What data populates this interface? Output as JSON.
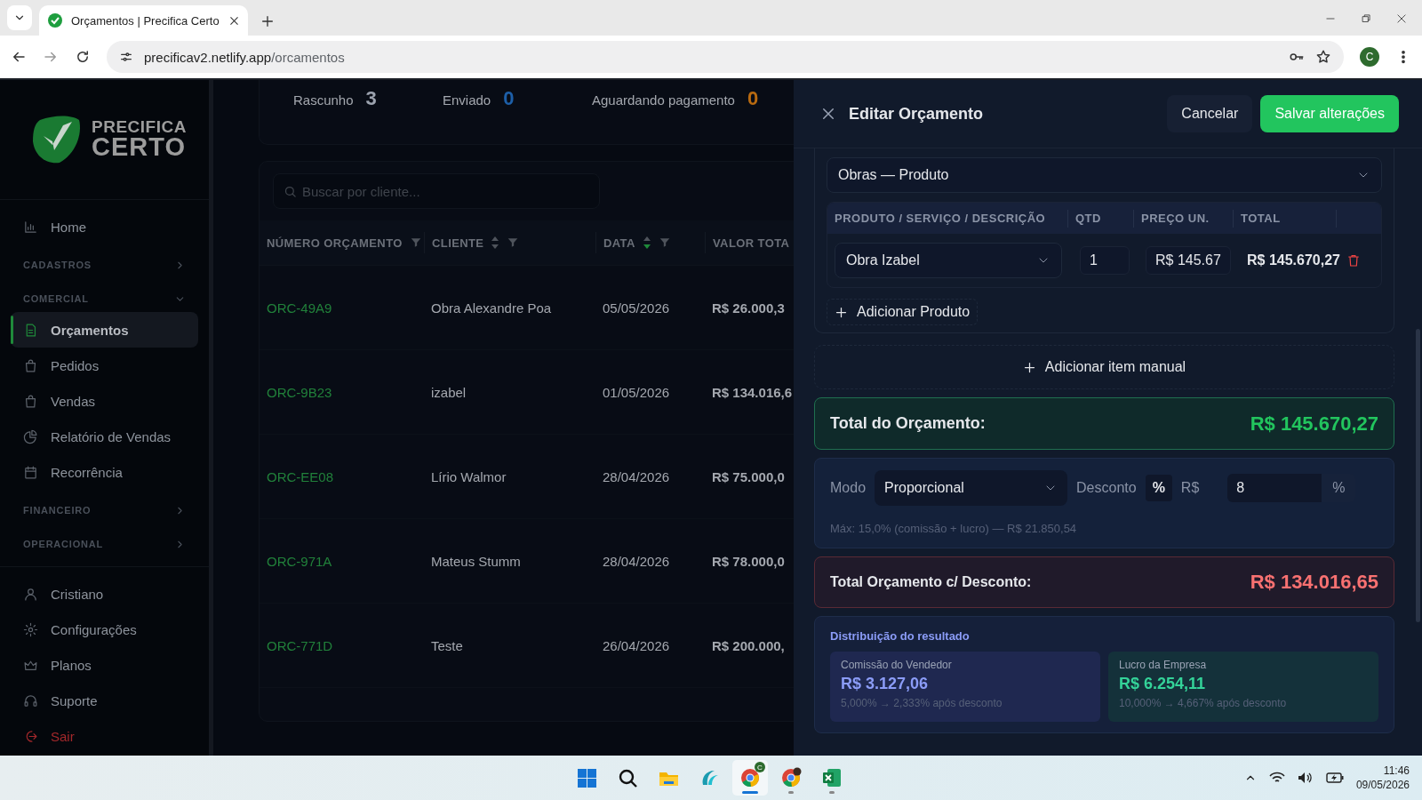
{
  "browser": {
    "tab_title": "Orçamentos | Precifica Certo",
    "url_host": "precificav2.netlify.app",
    "url_path": "/orcamentos",
    "profile_initial": "C"
  },
  "sidebar": {
    "logo": {
      "line1": "PRECIFICA",
      "line2": "CERTO"
    },
    "items": [
      {
        "kind": "link",
        "label": "Home",
        "selected": false
      },
      {
        "kind": "section",
        "label": "CADASTROS",
        "expanded": false
      },
      {
        "kind": "section",
        "label": "COMERCIAL",
        "expanded": true
      },
      {
        "kind": "link",
        "label": "Orçamentos",
        "selected": true
      },
      {
        "kind": "link",
        "label": "Pedidos",
        "selected": false
      },
      {
        "kind": "link",
        "label": "Vendas",
        "selected": false
      },
      {
        "kind": "link",
        "label": "Relatório de Vendas",
        "selected": false
      },
      {
        "kind": "link",
        "label": "Recorrência",
        "selected": false
      },
      {
        "kind": "section",
        "label": "FINANCEIRO",
        "expanded": false
      },
      {
        "kind": "section",
        "label": "OPERACIONAL",
        "expanded": false
      }
    ],
    "footer_items": [
      {
        "kind": "link",
        "label": "Cristiano",
        "selected": false
      },
      {
        "kind": "link",
        "label": "Configurações",
        "selected": false
      },
      {
        "kind": "link",
        "label": "Planos",
        "selected": false
      },
      {
        "kind": "link",
        "label": "Suporte",
        "selected": false
      },
      {
        "kind": "logout",
        "label": "Sair",
        "selected": false
      }
    ]
  },
  "statuses": [
    {
      "label": "Rascunho",
      "count": "3",
      "color": "#9ca3af"
    },
    {
      "label": "Enviado",
      "count": "0",
      "color": "#1d5fa8"
    },
    {
      "label": "Aguardando pagamento",
      "count": "0",
      "color": "#b86a10"
    }
  ],
  "table": {
    "search": {
      "placeholder": "Buscar por cliente..."
    },
    "columns": [
      {
        "label": "NÚMERO ORÇAMENTO",
        "kind": "filter"
      },
      {
        "label": "CLIENTE",
        "kind": "sort_filter",
        "sorted": false
      },
      {
        "label": "DATA",
        "kind": "sort_filter",
        "sorted": true
      },
      {
        "label": "VALOR TOTA",
        "kind": "plain"
      }
    ],
    "rows": [
      {
        "number": "ORC-49A9",
        "client": "Obra Alexandre Poa",
        "date": "05/05/2026",
        "total": "R$ 26.000,3"
      },
      {
        "number": "ORC-9B23",
        "client": "izabel",
        "date": "01/05/2026",
        "total": "R$ 134.016,6"
      },
      {
        "number": "ORC-EE08",
        "client": "Lírio Walmor",
        "date": "28/04/2026",
        "total": "R$ 75.000,0"
      },
      {
        "number": "ORC-971A",
        "client": "Mateus Stumm",
        "date": "28/04/2026",
        "total": "R$ 78.000,0"
      },
      {
        "number": "ORC-771D",
        "client": "Teste",
        "date": "26/04/2026",
        "total": "R$ 200.000,"
      }
    ]
  },
  "drawer": {
    "title": "Editar Orçamento",
    "cancel": "Cancelar",
    "save": "Salvar alterações",
    "category": "Obras — Produto",
    "item_columns": [
      "PRODUTO / SERVIÇO / DESCRIÇÃO",
      "QTD",
      "PREÇO UN.",
      "TOTAL"
    ],
    "items": [
      {
        "product": "Obra Izabel",
        "qty": "1",
        "price": "R$ 145.67",
        "total": "R$ 145.670,27"
      }
    ],
    "add_product": "Adicionar Produto",
    "add_manual": "Adicionar item manual",
    "total": {
      "label": "Total do Orçamento:",
      "value": "R$ 145.670,27"
    },
    "discount": {
      "mode_label": "Modo",
      "mode": "Proporcional",
      "label": "Desconto",
      "units": [
        {
          "label": "%",
          "selected": true
        },
        {
          "label": "R$",
          "selected": false
        }
      ],
      "value": "8",
      "suffix": "%",
      "hint": "Máx: 15,0% (comissão + lucro) — R$ 21.850,54"
    },
    "discounted_total": {
      "label": "Total Orçamento c/ Desconto:",
      "value": "R$ 134.016,65"
    },
    "distribution": {
      "title": "Distribuição do resultado",
      "cards": [
        {
          "label": "Comissão do Vendedor",
          "value": "R$ 3.127,06",
          "note": "5,000% → 2,333% após desconto",
          "color": "#8b9cf7"
        },
        {
          "label": "Lucro da Empresa",
          "value": "R$ 6.254,11",
          "note": "10,000% → 4,667% após desconto",
          "color": "#34d399"
        }
      ]
    }
  },
  "taskbar": {
    "apps": [
      {
        "running": false,
        "active": false
      },
      {
        "running": false,
        "active": false
      },
      {
        "running": false,
        "active": false
      },
      {
        "running": false,
        "active": false
      },
      {
        "running": true,
        "active": true,
        "badge": "C"
      },
      {
        "running": true,
        "active": false
      },
      {
        "running": true,
        "active": false
      }
    ],
    "time": "11:46",
    "date": "09/05/2026"
  }
}
